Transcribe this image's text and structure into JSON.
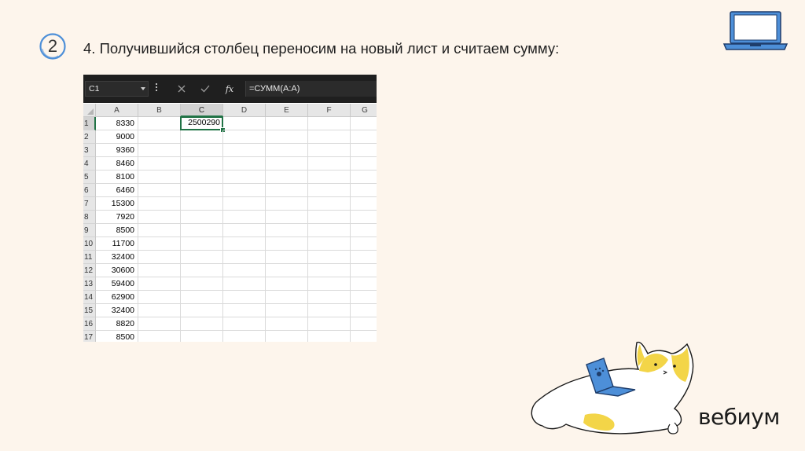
{
  "slide": {
    "step_number": "2",
    "title": "4. Получившийся столбец переносим на новый лист и считаем сумму:",
    "brand": "вебиум",
    "accent_color": "#4d8fd8",
    "cat_yellow": "#f3d548",
    "laptop_blue": "#4d8fd8"
  },
  "formula_bar": {
    "name_box": "C1",
    "cancel_icon": "close-icon",
    "enter_icon": "check-icon",
    "fx_label": "fx",
    "formula": "=СУММ(A:A)"
  },
  "sheet": {
    "columns": [
      "A",
      "B",
      "C",
      "D",
      "E",
      "F",
      "G"
    ],
    "active_column": "C",
    "active_row": "1",
    "rows": [
      {
        "num": "1",
        "a": "8330",
        "c": "2500290"
      },
      {
        "num": "2",
        "a": "9000",
        "c": ""
      },
      {
        "num": "3",
        "a": "9360",
        "c": ""
      },
      {
        "num": "4",
        "a": "8460",
        "c": ""
      },
      {
        "num": "5",
        "a": "8100",
        "c": ""
      },
      {
        "num": "6",
        "a": "6460",
        "c": ""
      },
      {
        "num": "7",
        "a": "15300",
        "c": ""
      },
      {
        "num": "8",
        "a": "7920",
        "c": ""
      },
      {
        "num": "9",
        "a": "8500",
        "c": ""
      },
      {
        "num": "10",
        "a": "11700",
        "c": ""
      },
      {
        "num": "11",
        "a": "32400",
        "c": ""
      },
      {
        "num": "12",
        "a": "30600",
        "c": ""
      },
      {
        "num": "13",
        "a": "59400",
        "c": ""
      },
      {
        "num": "14",
        "a": "62900",
        "c": ""
      },
      {
        "num": "15",
        "a": "32400",
        "c": ""
      },
      {
        "num": "16",
        "a": "8820",
        "c": ""
      },
      {
        "num": "17",
        "a": "8500",
        "c": ""
      }
    ]
  }
}
